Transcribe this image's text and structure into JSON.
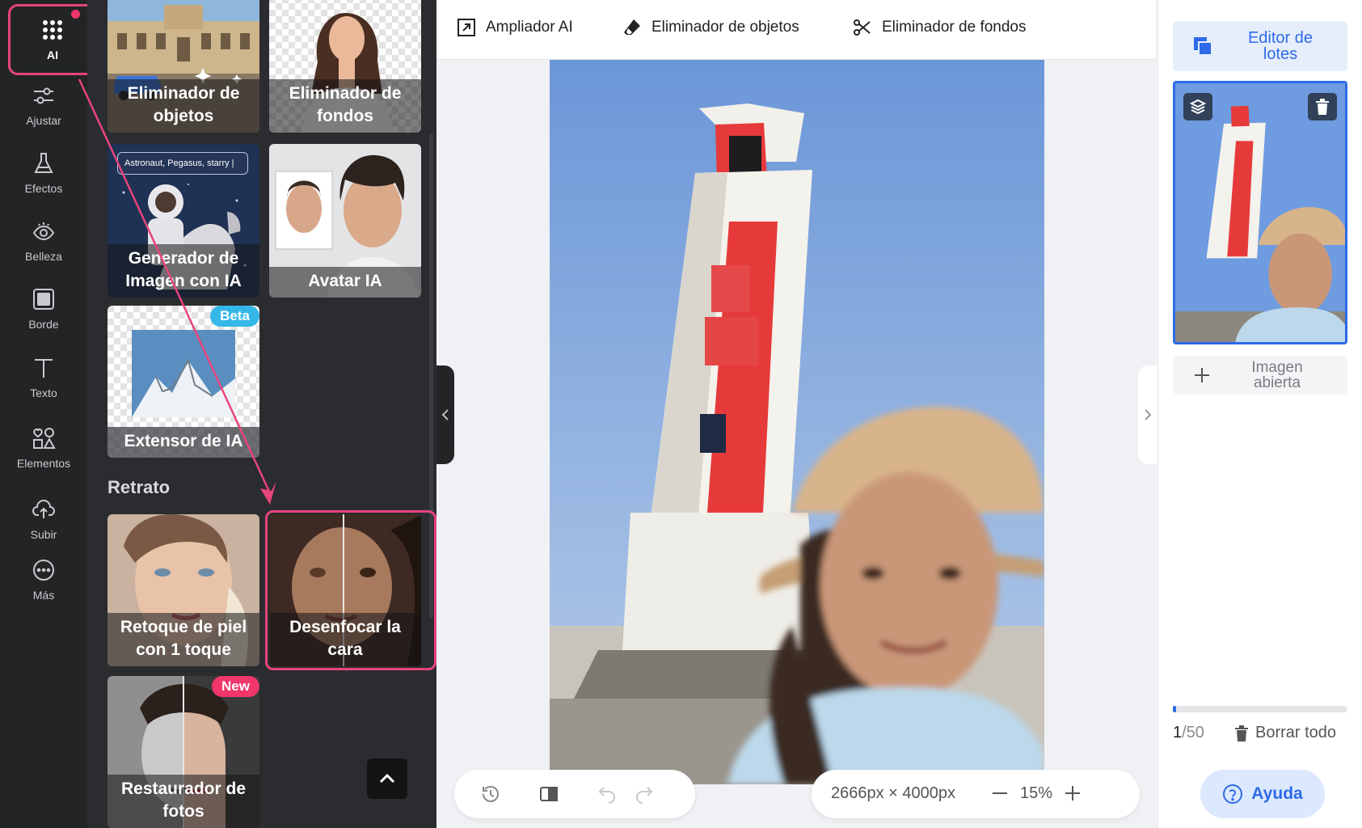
{
  "rail": {
    "items": [
      {
        "label": "AI",
        "icon": "grid-dots-icon"
      },
      {
        "label": "Ajustar",
        "icon": "sliders-icon"
      },
      {
        "label": "Efectos",
        "icon": "flask-icon"
      },
      {
        "label": "Belleza",
        "icon": "eye-icon"
      },
      {
        "label": "Borde",
        "icon": "square-frame-icon"
      },
      {
        "label": "Texto",
        "icon": "text-t-icon"
      },
      {
        "label": "Elementos",
        "icon": "shapes-icon"
      },
      {
        "label": "Subir",
        "icon": "cloud-upload-icon"
      },
      {
        "label": "Más",
        "icon": "more-dots-icon"
      }
    ]
  },
  "panel": {
    "cards": {
      "objetos": "Eliminador de objetos",
      "fondos": "Eliminador de fondos",
      "generador": "Generador de Imagen con IA",
      "generador_prompt": "Astronaut, Pegasus, starry",
      "avatar": "Avatar IA",
      "extensor": "Extensor de IA",
      "extensor_badge": "Beta",
      "retoque": "Retoque de piel con 1 toque",
      "desenfocar": "Desenfocar la cara",
      "restaurador": "Restaurador de fotos",
      "restaurador_badge": "New"
    },
    "section_retrato": "Retrato"
  },
  "topbar": {
    "tools": [
      "Ampliador AI",
      "Eliminador de objetos",
      "Eliminador de fondos"
    ]
  },
  "canvas": {
    "dimensions": "2666px × 4000px",
    "zoom": "15%"
  },
  "right_panel": {
    "batch_editor": "Editor de lotes",
    "open_image": "Imagen abierta",
    "count_current": "1",
    "count_total": "/50",
    "progress_fraction": 0.02,
    "clear_all": "Borrar todo",
    "help": "Ayuda"
  },
  "colors": {
    "accent": "#2d6be8",
    "highlight": "#e8447c",
    "rail_bg": "#232426",
    "panel_bg": "#2b2c2f"
  }
}
